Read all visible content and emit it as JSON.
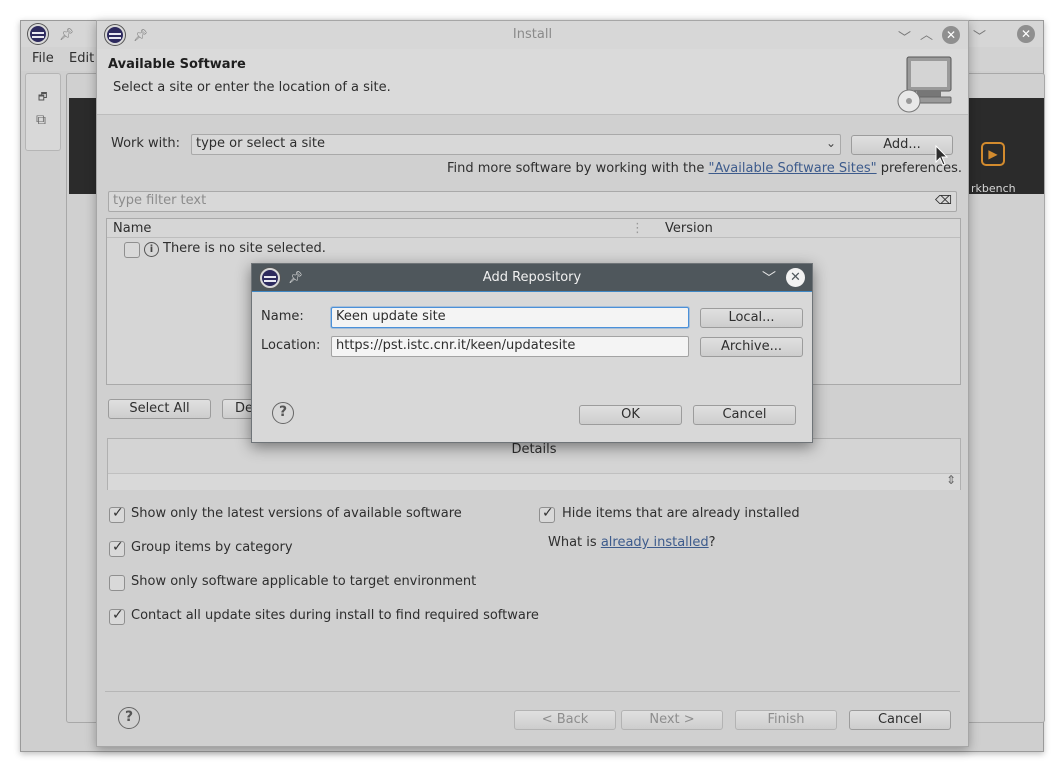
{
  "eclipse": {
    "menu": [
      "File",
      "Edit"
    ],
    "workbench_label": "rkbench"
  },
  "install": {
    "window_title": "Install",
    "header_title": "Available Software",
    "header_desc": "Select a site or enter the location of a site.",
    "work_with_label": "Work with:",
    "work_with_value": "type or select a site",
    "add_button": "Add...",
    "find_more_prefix": "Find more software by working with the ",
    "find_more_link": "\"Available Software Sites\"",
    "find_more_suffix": " preferences.",
    "filter_placeholder": "type filter text",
    "table_col_name": "Name",
    "table_col_version": "Version",
    "table_empty_row": "There is no site selected.",
    "select_all_button": "Select All",
    "deselect_all_button_partial": "De",
    "details_label": "Details",
    "options": {
      "latest_versions": "Show only the latest versions of available software",
      "hide_installed": "Hide items that are already installed",
      "group_by_category": "Group items by category",
      "what_is_prefix": "What is ",
      "already_installed_link": "already installed",
      "what_is_suffix": "?",
      "target_env": "Show only software applicable to target environment",
      "contact_sites": "Contact all update sites during install to find required software"
    },
    "buttons": {
      "back": "< Back",
      "next": "Next >",
      "finish": "Finish",
      "cancel": "Cancel"
    }
  },
  "repo_dialog": {
    "title": "Add Repository",
    "name_label": "Name:",
    "name_value": "Keen update site",
    "location_label": "Location:",
    "location_value": "https://pst.istc.cnr.it/keen/updatesite",
    "local_button": "Local...",
    "archive_button": "Archive...",
    "ok_button": "OK",
    "cancel_button": "Cancel"
  }
}
